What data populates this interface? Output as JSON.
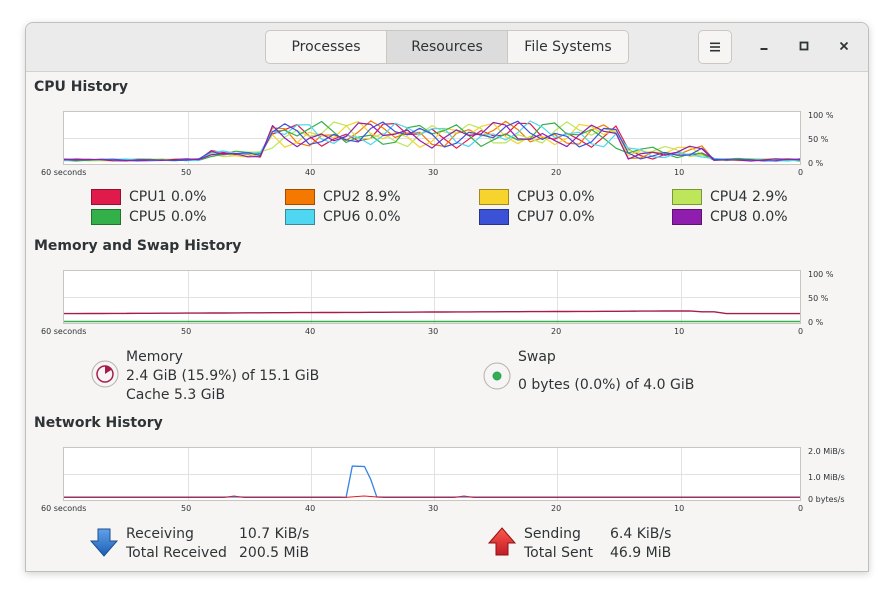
{
  "tabs": [
    {
      "label": "Processes",
      "active": false
    },
    {
      "label": "Resources",
      "active": true
    },
    {
      "label": "File Systems",
      "active": false
    }
  ],
  "header_icons": {
    "menu": "hamburger-menu-icon",
    "minimize": "minimize-icon",
    "maximize": "maximize-icon",
    "close": "close-icon"
  },
  "cpu": {
    "title": "CPU History",
    "y_ticks": [
      "100 %",
      "50 %",
      "0 %"
    ],
    "x_ticks": [
      "60 seconds",
      "50",
      "40",
      "30",
      "20",
      "10",
      "0"
    ],
    "cores": [
      {
        "label": "CPU1",
        "value": "0.0%",
        "color": "#e01b4c"
      },
      {
        "label": "CPU2",
        "value": "8.9%",
        "color": "#f57900"
      },
      {
        "label": "CPU3",
        "value": "0.0%",
        "color": "#f6d32d"
      },
      {
        "label": "CPU4",
        "value": "2.9%",
        "color": "#bde65a"
      },
      {
        "label": "CPU5",
        "value": "0.0%",
        "color": "#33b04a"
      },
      {
        "label": "CPU6",
        "value": "0.0%",
        "color": "#4fd6f0"
      },
      {
        "label": "CPU7",
        "value": "0.0%",
        "color": "#3b52d6"
      },
      {
        "label": "CPU8",
        "value": "0.0%",
        "color": "#8f1eae"
      }
    ]
  },
  "memory": {
    "title": "Memory and Swap History",
    "y_ticks": [
      "100 %",
      "50 %",
      "0 %"
    ],
    "x_ticks": [
      "60 seconds",
      "50",
      "40",
      "30",
      "20",
      "10",
      "0"
    ],
    "memory_label": "Memory",
    "memory_usage": "2.4 GiB (15.9%) of 15.1 GiB",
    "memory_cache": "Cache 5.3 GiB",
    "memory_color": "#a51d4f",
    "memory_fraction": 0.159,
    "swap_label": "Swap",
    "swap_usage": "0 bytes (0.0%) of 4.0 GiB",
    "swap_color": "#33b04a",
    "swap_fraction": 0.0
  },
  "network": {
    "title": "Network History",
    "y_ticks": [
      "2.0 MiB/s",
      "1.0 MiB/s",
      "0 bytes/s"
    ],
    "x_ticks": [
      "60 seconds",
      "50",
      "40",
      "30",
      "20",
      "10",
      "0"
    ],
    "receiving_label": "Receiving",
    "receiving_value": "10.7 KiB/s",
    "total_received_label": "Total Received",
    "total_received_value": "200.5 MiB",
    "sending_label": "Sending",
    "sending_value": "6.4 KiB/s",
    "total_sent_label": "Total Sent",
    "total_sent_value": "46.9 MiB",
    "receiving_color": "#3584e4",
    "sending_color": "#e01b24"
  }
}
